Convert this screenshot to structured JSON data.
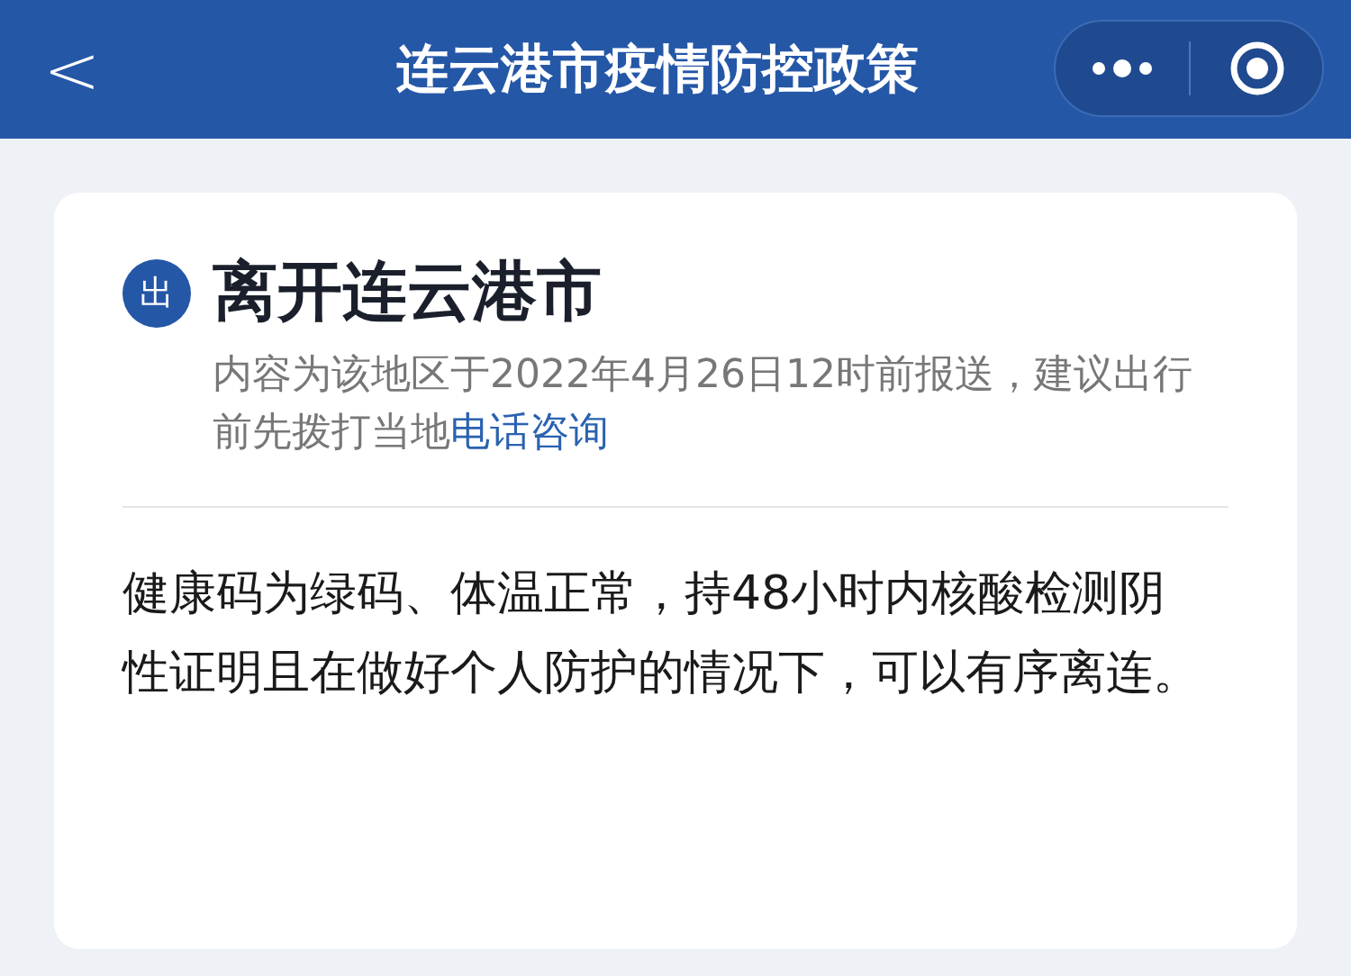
{
  "nav_bar": {
    "back": "<",
    "title": "连云港市疫情防控政策"
  },
  "card": {
    "badge": "出",
    "title": "离开连云港市",
    "note": "内容为该地区于2022年4月26日12时前报送，建议出行前先拨打当地",
    "note_link": "电话咨询",
    "body": "健康码为绿码、体温正常，持48小时内核酸检测阴性证明且在做好个人防护的情况下，可以有序离连。"
  }
}
